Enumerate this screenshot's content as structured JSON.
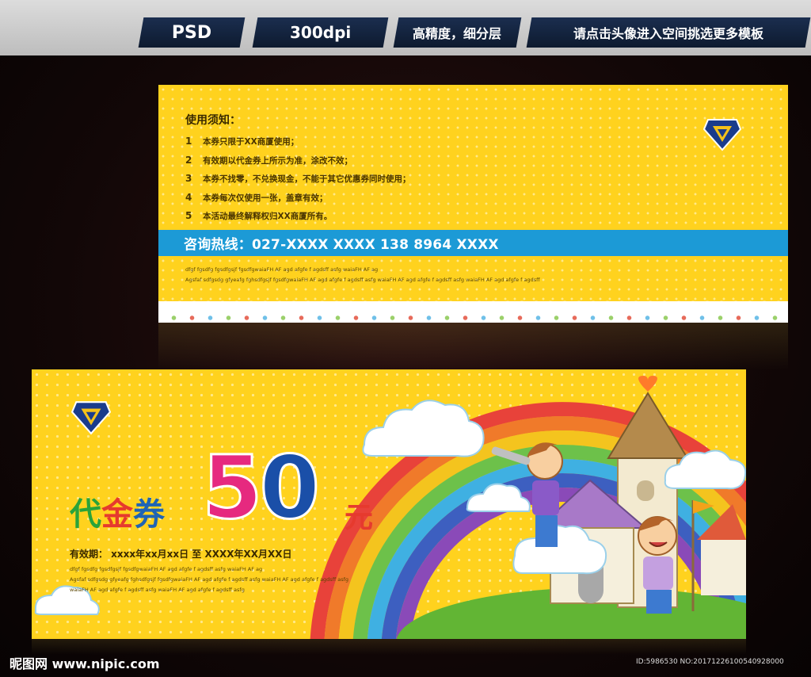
{
  "header": {
    "tab_format": "PSD",
    "tab_dpi": "300dpi",
    "tab_quality": "高精度，细分层",
    "tab_more": "请点击头像进入空间挑选更多模板"
  },
  "back_card": {
    "heading": "使用须知：",
    "rules": [
      {
        "num": "1",
        "text": "本券只限于XX商厦使用；"
      },
      {
        "num": "2",
        "text": "有效期以代金券上所示为准，涂改不效；"
      },
      {
        "num": "3",
        "text": "本券不找零，不兑换现金，不能于其它优惠券同时使用；"
      },
      {
        "num": "4",
        "text": "本券每次仅使用一张，盖章有效；"
      },
      {
        "num": "5",
        "text": "本活动最终解释权归XX商厦所有。"
      }
    ],
    "hotline": "咨询热线：027-XXXX XXXX   138 8964 XXXX",
    "filler_line_1": "dfgf fgsdfg   fgsdfgsjf fgsdfgwaiaFH AF agd afgfe f agdsff   asfg   waiaFH AF ag",
    "filler_line_2": "Agsfaf sdfgsdg gfyeafg fghsdfgsjf fgsdfgwaiaFH AF agd afgfe f agdsff   asfg   waiaFH AF agd afgfe f agdsff   asfg   waiaFH AF agd afgfe f agdsff"
  },
  "front_card": {
    "title_part1": "代",
    "title_part2": "金",
    "title_part3": "券",
    "amount_digit1": "5",
    "amount_digit2": "0",
    "unit": "元",
    "validity": "有效期：   xxxx年xx月xx日    至    XXXX年XX月XX日",
    "filler_line_1": "dfgf fgsdfg   fgsdfgsjf fgsdfgwaiaFH AF agd afgfe f agdsff   asfg   waiaFH AF ag",
    "filler_line_2": "Agsfaf sdfgsdg gfyeafg fghsdfgsjf fgsdfgwaiaFH AF agd afgfe f agdsff   asfg   waiaFH AF agd afgfe f agdsff   asfg",
    "filler_line_3": "waiaFH AF agd afgfe f agdsff   asfg   waiaFH AF agd afgfe f agdsff   asfg"
  },
  "watermark": {
    "site": "昵图网 www.nipic.com",
    "id": "ID:5986530 NO:20171226100540928000"
  },
  "colors": {
    "card_yellow": "#ffd21e",
    "hotline_blue": "#1c9ad6",
    "number_pink": "#e6297f",
    "number_blue": "#1a4fa8"
  }
}
